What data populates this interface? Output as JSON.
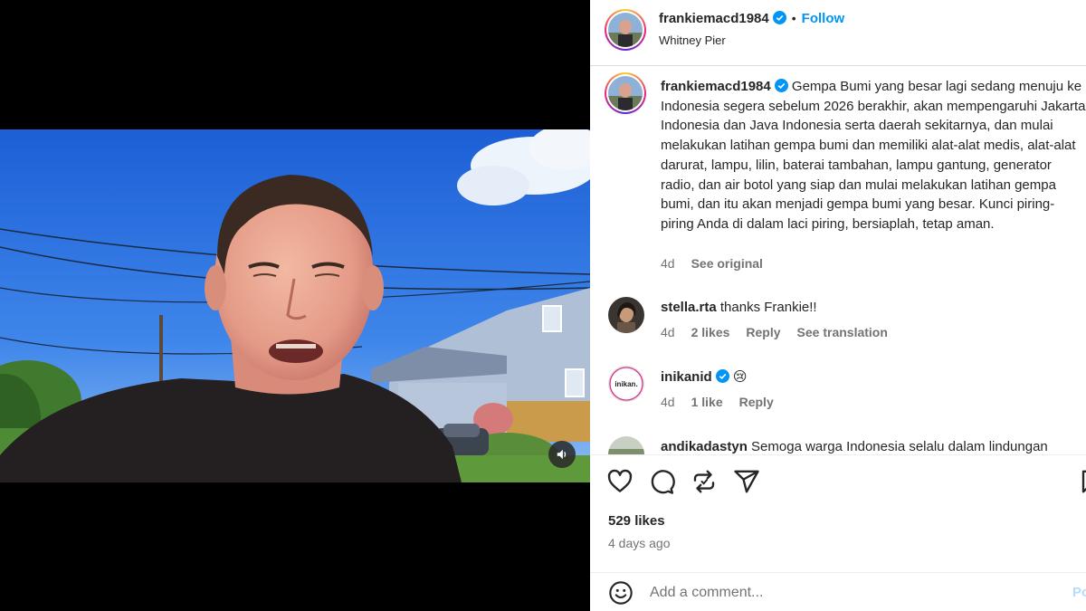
{
  "header": {
    "username": "frankiemacd1984",
    "separator": "•",
    "follow_label": "Follow",
    "location": "Whitney Pier"
  },
  "caption": {
    "username": "frankiemacd1984",
    "text": "Gempa Bumi yang besar lagi sedang menuju ke Indonesia segera sebelum 2026 berakhir, akan mempengaruhi Jakarta Indonesia dan Java Indonesia serta daerah sekitarnya, dan mulai melakukan latihan gempa bumi dan memiliki alat-alat medis, alat-alat darurat, lampu, lilin, baterai tambahan, lampu gantung, generator radio, dan air botol yang siap dan mulai melakukan latihan gempa bumi, dan itu akan menjadi gempa bumi yang besar. Kunci piring-piring Anda di dalam laci piring, bersiaplah, tetap aman.",
    "time": "4d",
    "see_original": "See original"
  },
  "comments": [
    {
      "username": "stella.rta",
      "text": "thanks Frankie!!",
      "time": "4d",
      "likes": "2 likes",
      "reply": "Reply",
      "translate": "See translation"
    },
    {
      "username": "inikanid",
      "text": "😢",
      "time": "4d",
      "likes": "1 like",
      "reply": "Reply",
      "avatar_text": "inikan."
    },
    {
      "username": "andikadastyn",
      "text": "Semoga warga Indonesia selalu dalam lindungan"
    }
  ],
  "actions": {
    "icons": [
      "heart-icon",
      "comment-icon",
      "repost-icon",
      "share-icon",
      "bookmark-icon"
    ],
    "likes": "529 likes",
    "posted_ago": "4 days ago"
  },
  "add_comment": {
    "placeholder": "Add a comment...",
    "post_label": "Post"
  },
  "colors": {
    "link": "#0095f6",
    "verified": "#0095f6",
    "muted_text": "#737373",
    "post_disabled": "#b3dbff"
  }
}
